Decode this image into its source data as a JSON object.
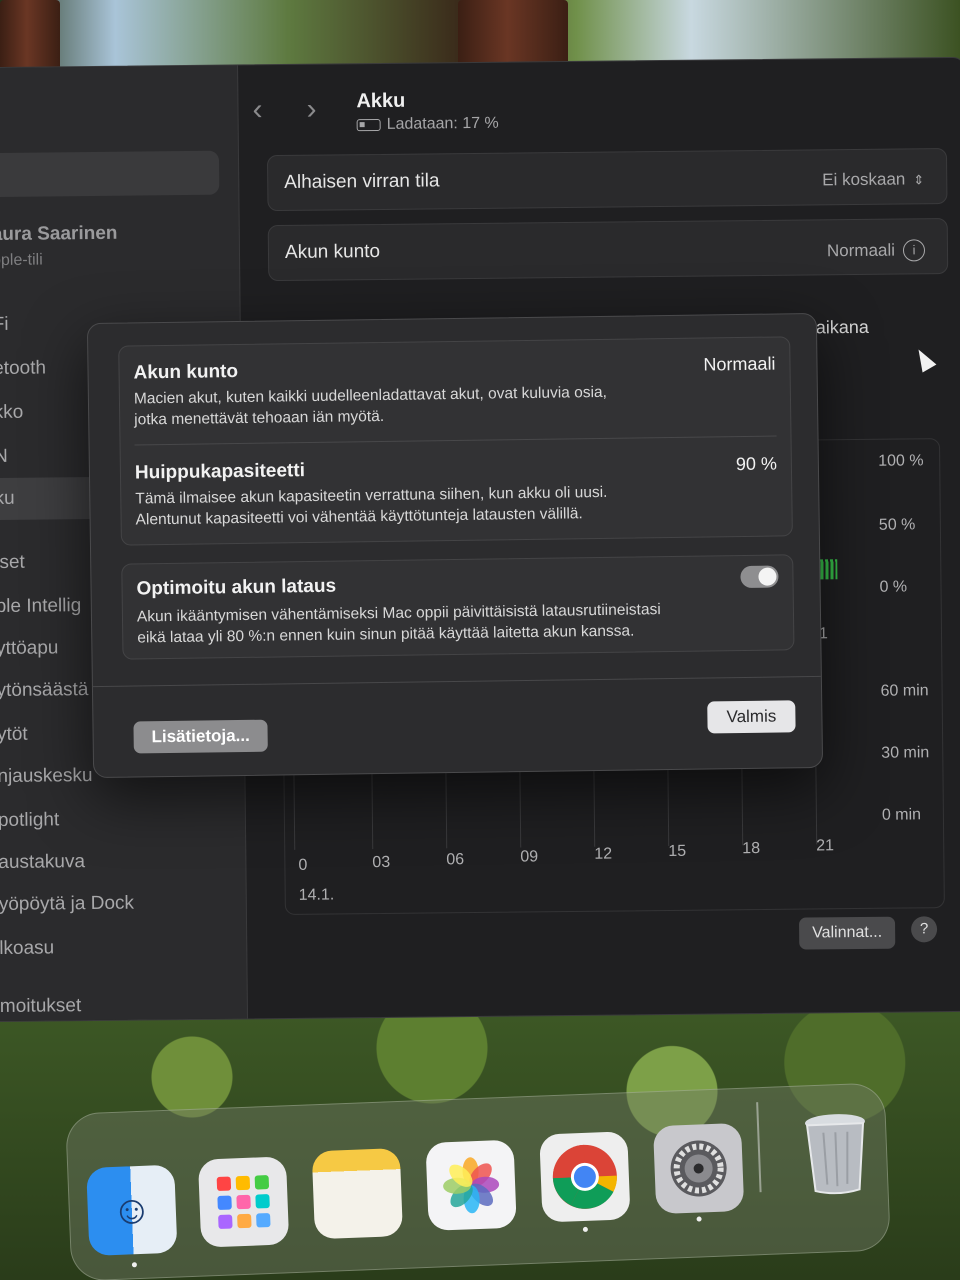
{
  "window": {
    "title": "Akku",
    "status": "Ladataan: 17 %"
  },
  "sidebar": {
    "user_name": "aura Saarinen",
    "user_sub": "pple-tili",
    "items": [
      {
        "label": "Fi"
      },
      {
        "label": "etooth"
      },
      {
        "label": "kko"
      },
      {
        "label": "N"
      },
      {
        "label": "ku"
      },
      {
        "label": "iset"
      },
      {
        "label": "ple Intellig"
      },
      {
        "label": "yttöapu"
      },
      {
        "label": "ytönsäästä"
      },
      {
        "label": "ytöt"
      },
      {
        "label": "njauskesku"
      },
      {
        "label": "potlight"
      },
      {
        "label": "austakuva"
      },
      {
        "label": "yöpöytä ja Dock"
      },
      {
        "label": "lkoasu"
      },
      {
        "label": "moitukset"
      }
    ]
  },
  "settings": {
    "low_power_label": "Alhaisen virran tila",
    "low_power_value": "Ei koskaan",
    "health_label": "Akun kunto",
    "health_value": "Normaali",
    "partial_row_text": "aikana"
  },
  "chart": {
    "y_pct": [
      "100 %",
      "50 %",
      "0 %"
    ],
    "y_min": [
      "60 min",
      "30 min",
      "0 min"
    ],
    "x_ticks": [
      "0",
      "03",
      "06",
      "09",
      "12",
      "15",
      "18",
      "21"
    ],
    "x_tick_upper": "21",
    "date": "14.1.",
    "options_label": "Valinnat...",
    "help_label": "?"
  },
  "modal": {
    "health": {
      "title": "Akun kunto",
      "value": "Normaali",
      "desc_line1": "Macien akut, kuten kaikki uudelleenladattavat akut, ovat kuluvia osia,",
      "desc_line2": "jotka menettävät tehoaan iän myötä."
    },
    "capacity": {
      "title": "Huippukapasiteetti",
      "value": "90 %",
      "desc_line1": "Tämä ilmaisee akun kapasiteetin verrattuna siihen, kun akku oli uusi.",
      "desc_line2": "Alentunut kapasiteetti voi vähentää käyttötunteja latausten välillä."
    },
    "optimized": {
      "title": "Optimoitu akun lataus",
      "enabled": true,
      "desc_line1": "Akun ikääntymisen vähentämiseksi Mac oppii päivittäisistä latausrutiineistasi",
      "desc_line2": "eikä lataa yli 80 %:n ennen kuin sinun pitää käyttää laitetta akun kanssa."
    },
    "more_info_label": "Lisätietoja...",
    "done_label": "Valmis"
  },
  "dock": {
    "apps": [
      {
        "name": "finder-icon"
      },
      {
        "name": "launchpad-icon"
      },
      {
        "name": "notes-icon"
      },
      {
        "name": "photos-icon"
      },
      {
        "name": "chrome-icon"
      },
      {
        "name": "system-settings-icon"
      },
      {
        "name": "trash-icon"
      }
    ]
  }
}
